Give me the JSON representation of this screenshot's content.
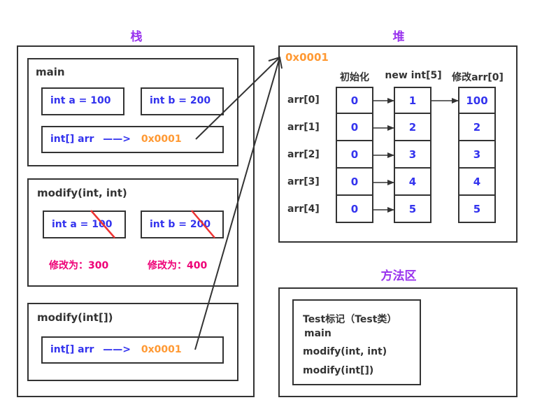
{
  "colors": {
    "section_title": "#9933ee",
    "variable_text": "#3333ee",
    "address_text": "#ff9933",
    "modified_text": "#ee0077",
    "label_text": "#333333",
    "strike": "#ee3333",
    "border": "#333333"
  },
  "stack": {
    "title": "栈",
    "frames": [
      {
        "name": "main",
        "vars": [
          {
            "text": "int a = 100"
          },
          {
            "text": "int b = 200"
          }
        ],
        "ref": {
          "label": "int[] arr",
          "arrow": "——>",
          "address": "0x0001"
        }
      },
      {
        "name": "modify(int, int)",
        "vars": [
          {
            "text": "int a = 100",
            "struck": true,
            "modified": "修改为：300"
          },
          {
            "text": "int b = 200",
            "struck": true,
            "modified": "修改为：400"
          }
        ]
      },
      {
        "name": "modify(int[])",
        "ref": {
          "label": "int[] arr",
          "arrow": "——>",
          "address": "0x0001"
        }
      }
    ]
  },
  "heap": {
    "title": "堆",
    "address": "0x0001",
    "column_headers": [
      "初始化",
      "new int[5]",
      "修改arr[0]"
    ],
    "row_labels": [
      "arr[0]",
      "arr[1]",
      "arr[2]",
      "arr[3]",
      "arr[4]"
    ],
    "columns": [
      [
        "0",
        "0",
        "0",
        "0",
        "0"
      ],
      [
        "1",
        "2",
        "3",
        "4",
        "5"
      ],
      [
        "100",
        "2",
        "3",
        "4",
        "5"
      ]
    ]
  },
  "method_area": {
    "title": "方法区",
    "lines": [
      "Test标记（Test类）",
      "main",
      "modify(int, int)",
      "modify(int[])"
    ]
  }
}
